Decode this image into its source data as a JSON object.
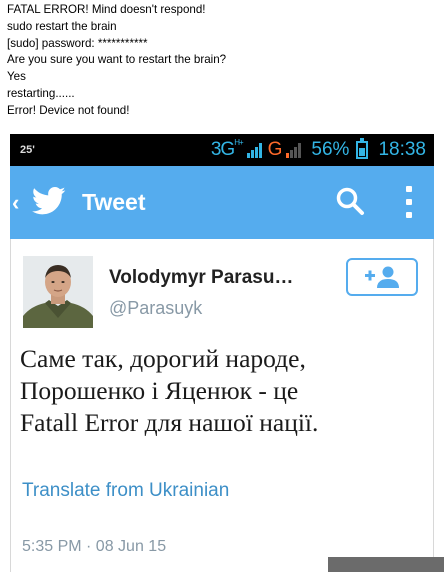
{
  "terminal": {
    "lines": [
      "FATAL ERROR! Mind doesn't respond!",
      "sudo restart the brain",
      "[sudo] password: ***********",
      "Are you sure you want to restart the brain?",
      "Yes",
      "restarting......",
      "Error! Device not found!"
    ]
  },
  "status_bar": {
    "notification": "25'",
    "network_primary": "3G",
    "network_primary_sup": "H+",
    "network_secondary": "G",
    "battery": "56%",
    "time": "18:38"
  },
  "app_bar": {
    "title": "Tweet",
    "icons": [
      "back-icon",
      "twitter-bird-icon",
      "search-icon",
      "overflow-menu-icon"
    ],
    "color": "#55acee"
  },
  "tweet": {
    "user_name": "Volodymyr Parasu…",
    "handle": "@Parasuyk",
    "text_lines": [
      "Саме так, дорогий народе,",
      "Порошенко і Яценюк - це",
      "Fatall Error для нашої нації."
    ],
    "translate_label": "Translate from Ukrainian",
    "timestamp": "5:35 PM · 08 Jun 15",
    "follow_icon": "add-user-icon"
  }
}
